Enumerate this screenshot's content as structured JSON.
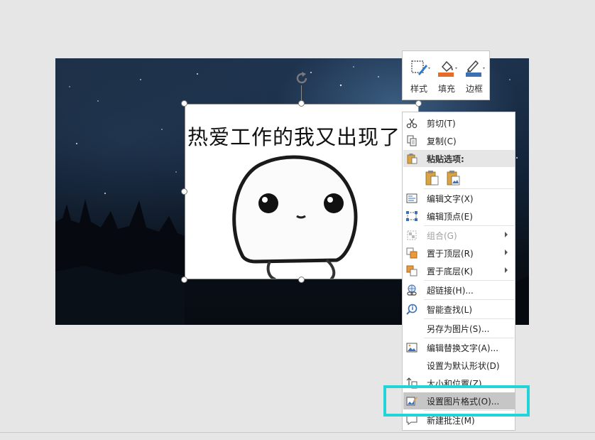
{
  "slide": {
    "picture": {
      "caption": "热爱工作的我又出现了"
    }
  },
  "mini_toolbar": {
    "buttons": [
      {
        "label": "样式",
        "icon": "style-icon"
      },
      {
        "label": "填充",
        "icon": "fill-icon"
      },
      {
        "label": "边框",
        "icon": "outline-icon"
      }
    ]
  },
  "context_menu": {
    "items": [
      {
        "label": "剪切(T)",
        "icon": "scissors-icon"
      },
      {
        "label": "复制(C)",
        "icon": "copy-icon"
      },
      {
        "label": "粘贴选项:",
        "icon": "clipboard-icon"
      },
      {
        "label": "编辑文字(X)",
        "icon": "edit-text-icon"
      },
      {
        "label": "编辑顶点(E)",
        "icon": "edit-points-icon"
      },
      {
        "label": "组合(G)",
        "icon": "group-icon",
        "disabled": true,
        "submenu": true
      },
      {
        "label": "置于顶层(R)",
        "icon": "bring-to-front-icon",
        "submenu": true
      },
      {
        "label": "置于底层(K)",
        "icon": "send-to-back-icon",
        "submenu": true
      },
      {
        "label": "超链接(H)...",
        "icon": "hyperlink-icon"
      },
      {
        "label": "智能查找(L)",
        "icon": "smart-lookup-icon"
      },
      {
        "label": "另存为图片(S)..."
      },
      {
        "label": "编辑替换文字(A)...",
        "icon": "alt-text-icon"
      },
      {
        "label": "设置为默认形状(D)"
      },
      {
        "label": "大小和位置(Z)...",
        "icon": "size-position-icon"
      },
      {
        "label": "设置图片格式(O)...",
        "icon": "format-picture-icon",
        "highlighted": true
      },
      {
        "label": "新建批注(M)",
        "icon": "comment-icon"
      }
    ]
  },
  "colors": {
    "fill_accent": "#e46c2a",
    "outline_accent": "#3d6fb6",
    "focus_box": "#22d3d8",
    "highlight": "#c6c6c6"
  }
}
